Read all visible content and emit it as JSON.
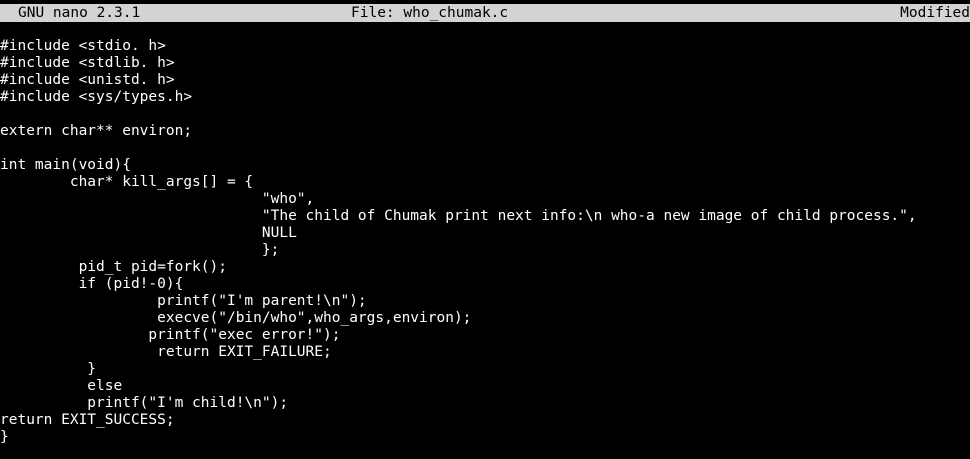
{
  "titlebar": {
    "app": "GNU nano 2.3.1",
    "file_label": "File: who_chumak.c",
    "status": "Modified"
  },
  "colors": {
    "background": "#000000",
    "text": "#ffffff",
    "titlebar_bg": "#d3d3d3",
    "titlebar_text": "#000000"
  },
  "editor": {
    "lines": [
      "#include <stdio. h>",
      "#include <stdlib. h>",
      "#include <unistd. h>",
      "#include <sys/types.h>",
      "",
      "extern char** environ;",
      "",
      "int main(void){",
      "        char* kill_args[] = {",
      "                              \"who\",",
      "                              \"The child of Chumak print next info:\\n who-a new image of child process.\",",
      "                              NULL",
      "                              };",
      "         pid_t pid=fork();",
      "         if (pid!-0){",
      "                  printf(\"I'm parent!\\n\");",
      "                  execve(\"/bin/who\",who_args,environ);",
      "                 printf(\"exec error!\");",
      "                  return EXIT_FAILURE;",
      "          }",
      "          else",
      "          printf(\"I'm child!\\n\");",
      "return EXIT_SUCCESS;",
      "}"
    ]
  }
}
